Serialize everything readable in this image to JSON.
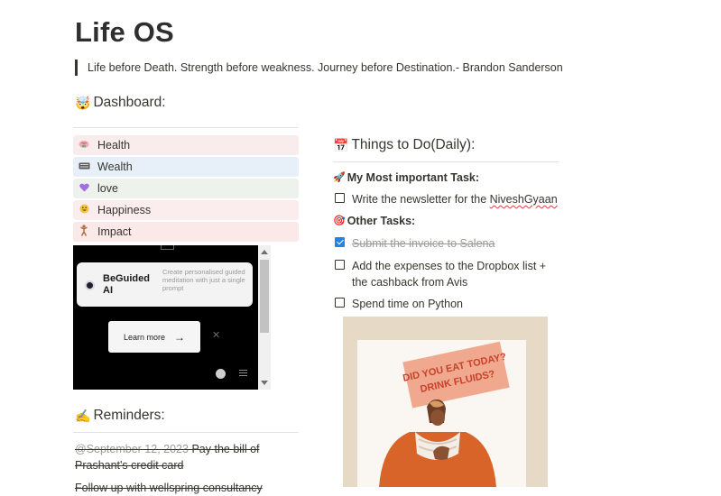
{
  "page": {
    "title": "Life OS"
  },
  "quote": "Life before Death. Strength before weakness. Journey before Destination.- Brandon Sanderson",
  "dashboard": {
    "emoji": "🤯",
    "heading": "Dashboard:"
  },
  "nav": [
    {
      "icon": "brain",
      "label": "Health",
      "bg": "#f9ecec"
    },
    {
      "icon": "keyboard",
      "label": "Wealth",
      "bg": "#e7f0f8"
    },
    {
      "icon": "heart",
      "label": "love",
      "bg": "#edf3ec"
    },
    {
      "icon": "smile",
      "label": "Happiness",
      "bg": "#fbecee"
    },
    {
      "icon": "person",
      "label": "Impact",
      "bg": "#fbe8e8"
    }
  ],
  "embed": {
    "brand": "BeGuided AI",
    "description": "Create personalised guided meditation with just a single prompt",
    "learn_more": "Learn more",
    "arrow": "→",
    "close": "✕"
  },
  "reminders": {
    "emoji": "✍️",
    "heading": "Reminders:",
    "item1_date": "@September 12, 2023",
    "item1_text": "Pay the bill of Prashant's credit card",
    "item2_text": "Follow up with wellspring consultancy"
  },
  "todo": {
    "emoji": "📅",
    "heading": "Things to Do(Daily):",
    "important": {
      "emoji": "🚀",
      "label": "My Most important Task:"
    },
    "task1_prefix": "Write the newsletter for the ",
    "task1_word": "NiveshGyaan",
    "other": {
      "emoji": "🎯",
      "label": "Other Tasks:"
    },
    "task2": "Submit the invoice to Salena",
    "task3": "Add the expenses to the Dropbox list + the cashback from Avis",
    "task4": "Spend time on Python"
  },
  "poster": {
    "line1": "DID YOU EAT TODAY?",
    "line2": "DRINK FLUIDS?",
    "colors": {
      "bg": "#e6d9c6",
      "card": "#faf6f1",
      "sign": "#f0a98e",
      "text": "#c8412b",
      "shirt": "#d9642a"
    }
  }
}
